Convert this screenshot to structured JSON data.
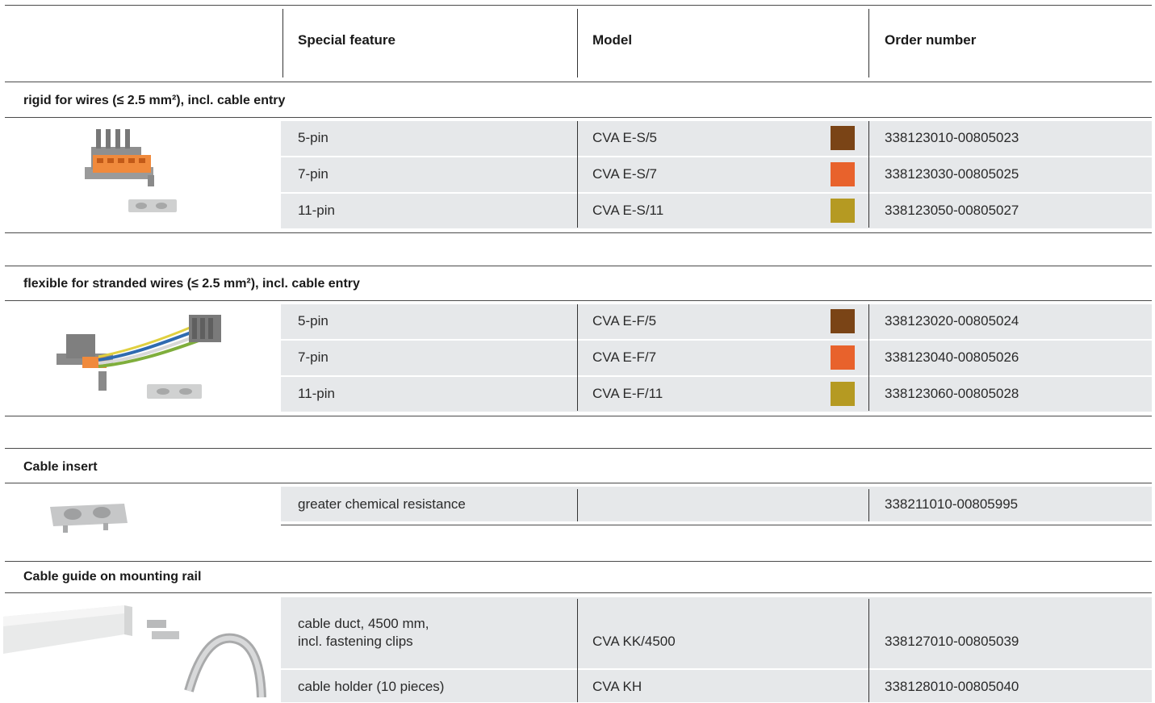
{
  "header": {
    "col_feature": "Special feature",
    "col_model": "Model",
    "col_order": "Order number"
  },
  "sections": [
    {
      "title": "rigid for wires (≤ 2.5 mm²), incl. cable entry",
      "rows": [
        {
          "feature": "5-pin",
          "model": "CVA E-S/5",
          "color": "#7a4416",
          "order": "338123010-00805023"
        },
        {
          "feature": "7-pin",
          "model": "CVA E-S/7",
          "color": "#e8622c",
          "order": "338123030-00805025"
        },
        {
          "feature": "11-pin",
          "model": "CVA E-S/11",
          "color": "#b59a22",
          "order": "338123050-00805027"
        }
      ]
    },
    {
      "title": "flexible for stranded wires (≤ 2.5 mm²), incl. cable entry",
      "rows": [
        {
          "feature": "5-pin",
          "model": "CVA E-F/5",
          "color": "#7a4416",
          "order": "338123020-00805024"
        },
        {
          "feature": "7-pin",
          "model": "CVA E-F/7",
          "color": "#e8622c",
          "order": "338123040-00805026"
        },
        {
          "feature": "11-pin",
          "model": "CVA E-F/11",
          "color": "#b59a22",
          "order": "338123060-00805028"
        }
      ]
    },
    {
      "title": "Cable insert",
      "rows": [
        {
          "feature": "greater chemical resistance",
          "model": "",
          "order": "338211010-00805995"
        }
      ]
    },
    {
      "title": "Cable guide on mounting rail",
      "rows": [
        {
          "feature_line1": "cable duct, 4500 mm,",
          "feature_line2": "incl. fastening clips",
          "model": "CVA KK/4500",
          "order": "338127010-00805039"
        },
        {
          "feature": "cable holder (10 pieces)",
          "model": "CVA KH",
          "order": "338128010-00805040"
        }
      ]
    }
  ]
}
